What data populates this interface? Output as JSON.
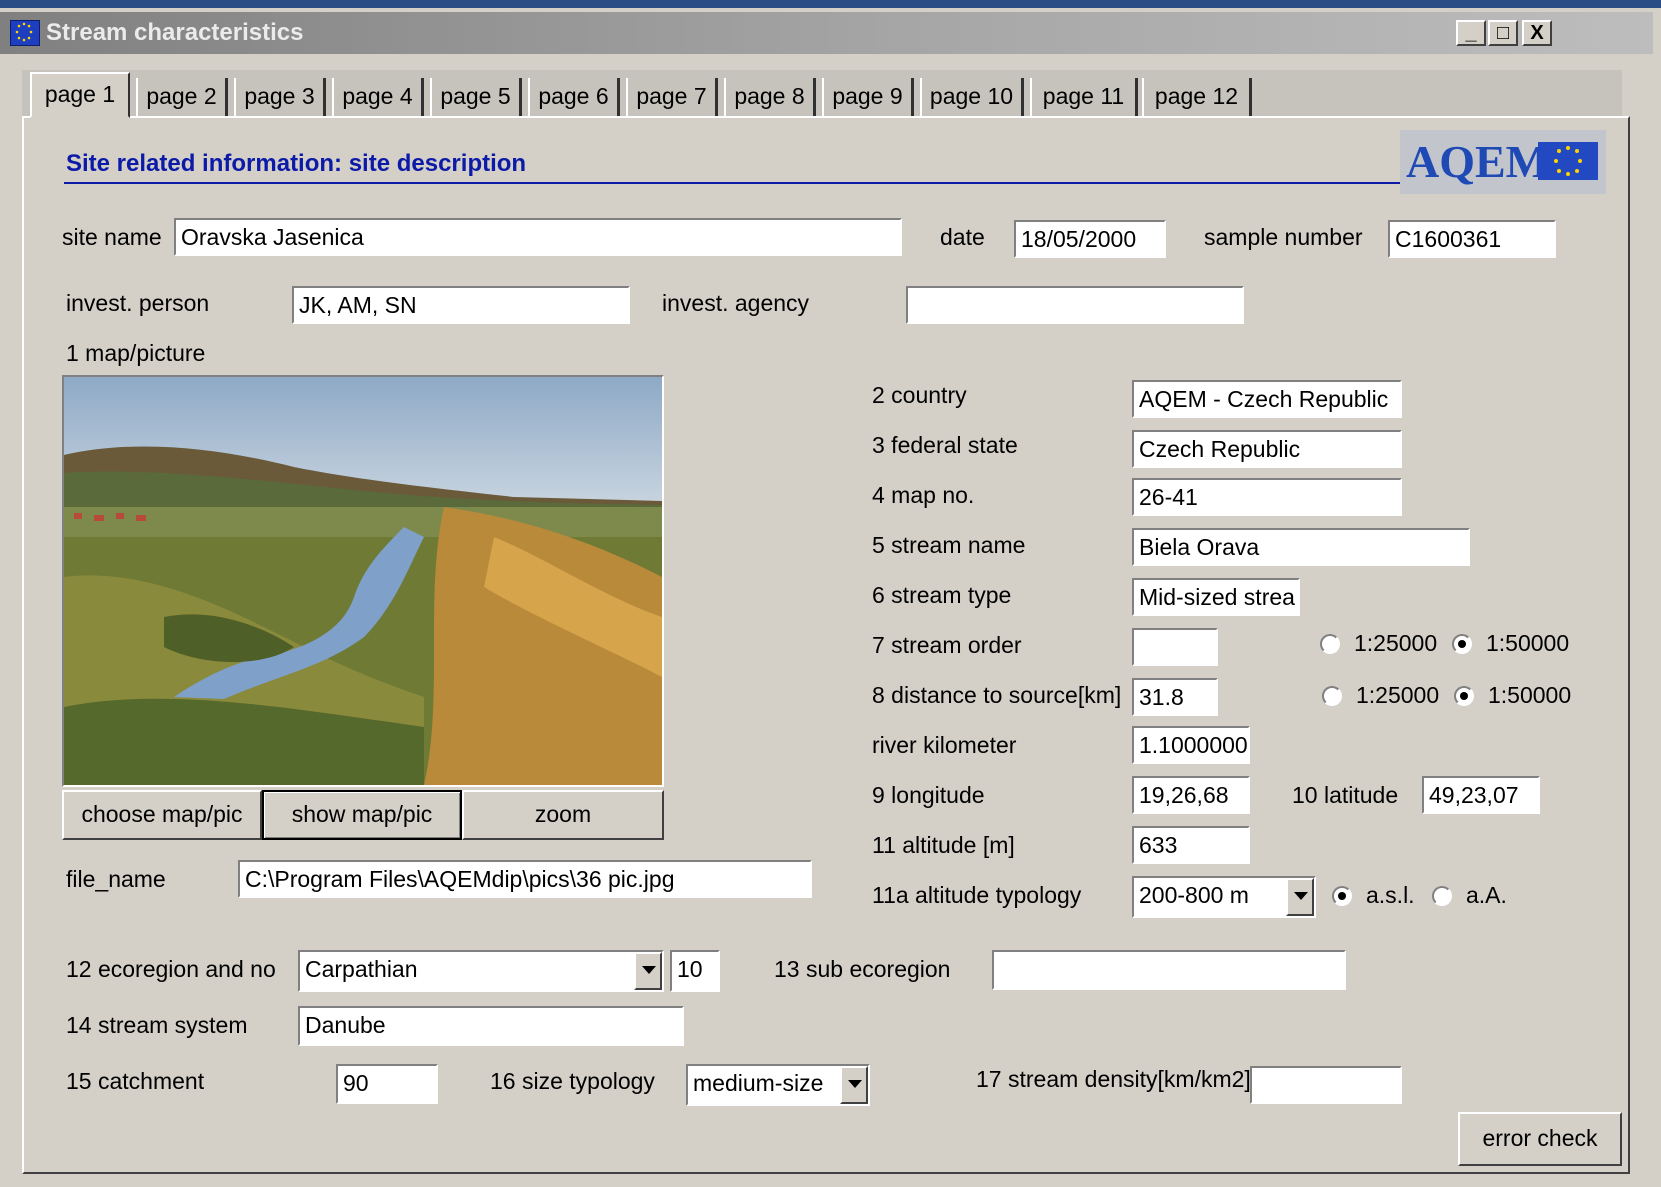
{
  "window": {
    "title": "Stream characteristics",
    "controls": {
      "minimize": "_",
      "maximize": "□",
      "close": "X"
    }
  },
  "tabs": [
    "page 1",
    "page 2",
    "page 3",
    "page 4",
    "page 5",
    "page 6",
    "page 7",
    "page 8",
    "page 9",
    "page 10",
    "page 11",
    "page 12"
  ],
  "active_tab": "page 1",
  "section": {
    "heading": "Site related information: site description",
    "logo_text": "AQEM"
  },
  "labels": {
    "site_name": "site name",
    "date": "date",
    "sample_number": "sample number",
    "invest_person": "invest. person",
    "invest_agency": "invest. agency",
    "map_picture": "1 map/picture",
    "country": "2 country",
    "federal_state": "3 federal state",
    "map_no": "4 map no.",
    "stream_name": "5 stream name",
    "stream_type": "6 stream type",
    "stream_order": "7 stream order",
    "distance_to_source": "8 distance to source[km]",
    "river_kilometer": "river kilometer",
    "longitude": "9 longitude",
    "latitude": "10 latitude",
    "altitude": "11 altitude [m]",
    "altitude_typology": "11a altitude typology",
    "file_name": "file_name",
    "ecoregion": "12 ecoregion and no",
    "sub_ecoregion": "13 sub ecoregion",
    "stream_system": "14 stream system",
    "catchment": "15 catchment",
    "size_typology": "16 size typology",
    "stream_density": "17 stream density[km/km2]"
  },
  "values": {
    "site_name": "Oravska Jasenica",
    "date": "18/05/2000",
    "sample_number": "C1600361",
    "invest_person": "JK, AM, SN",
    "invest_agency": "",
    "country": "AQEM - Czech Republic",
    "federal_state": "Czech Republic",
    "map_no": "26-41",
    "stream_name": "Biela Orava",
    "stream_type": "Mid-sized strea",
    "stream_order": "",
    "distance_to_source": "31.8",
    "river_kilometer": "1.1000000",
    "longitude": "19,26,68",
    "latitude": "49,23,07",
    "altitude": "633",
    "altitude_typology": "200-800 m",
    "file_name": "C:\\Program Files\\AQEMdip\\pics\\36 pic.jpg",
    "ecoregion": "Carpathian",
    "ecoregion_no": "10",
    "sub_ecoregion": "",
    "stream_system": "Danube",
    "catchment": "90",
    "size_typology": "medium-size",
    "stream_density": ""
  },
  "scale_options": {
    "stream_order": {
      "opt1": "1:25000",
      "opt2": "1:50000",
      "selected": "1:50000"
    },
    "distance": {
      "opt1": "1:25000",
      "opt2": "1:50000",
      "selected": "1:50000"
    }
  },
  "altitude_reference": {
    "opt1": "a.s.l.",
    "opt2": "a.A.",
    "selected": "a.s.l."
  },
  "buttons": {
    "choose": "choose map/pic",
    "show": "show map/pic",
    "zoom": "zoom",
    "error_check": "error check"
  }
}
